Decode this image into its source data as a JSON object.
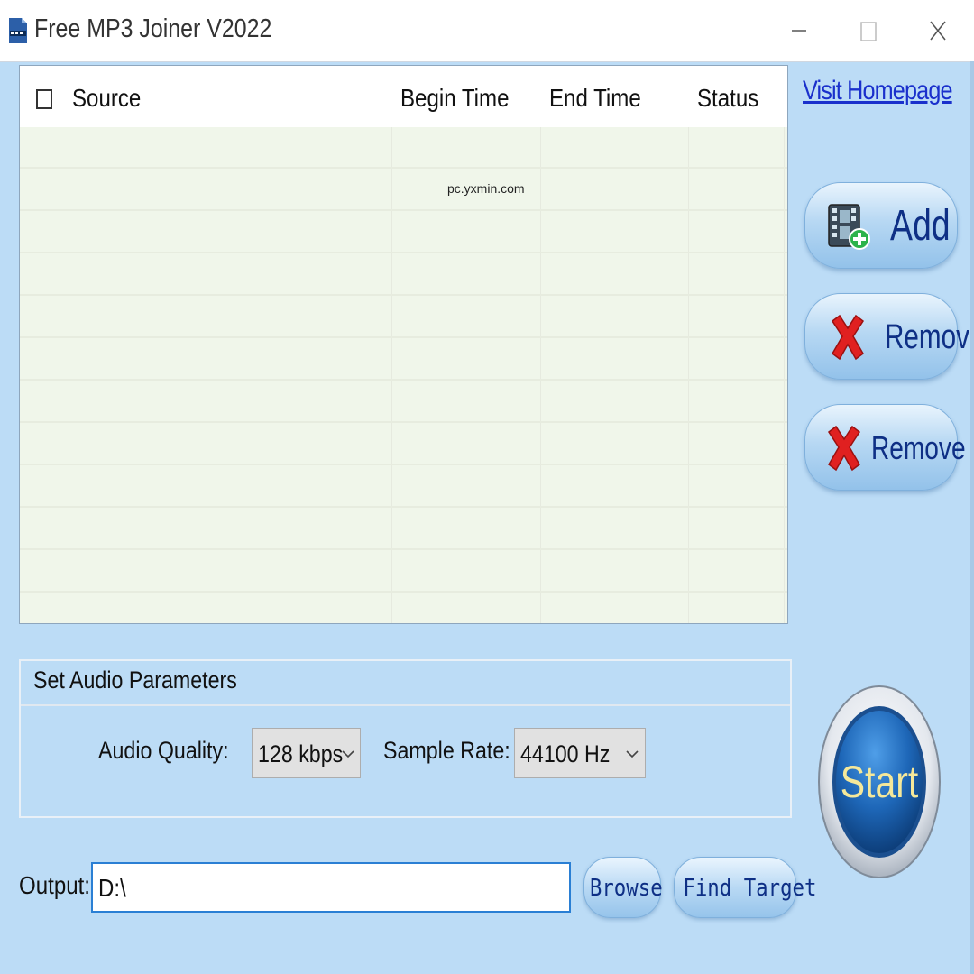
{
  "window": {
    "title": "Free MP3 Joiner V2022",
    "controls": [
      "minimize",
      "maximize",
      "close"
    ]
  },
  "file_list": {
    "columns": [
      "Source",
      "Begin Time",
      "End Time",
      "Status"
    ],
    "select_all_checked": false,
    "rows": [],
    "watermark": "pc.yxmin.com"
  },
  "sidebar": {
    "homepage_link": "Visit Homepage",
    "add_label": "Add",
    "remove_label": "Remove",
    "remove_all_label": "Remove All"
  },
  "audio_params": {
    "group_title": "Set Audio Parameters",
    "quality_label": "Audio Quality:",
    "quality_value": "128 kbps",
    "sample_rate_label": "Sample Rate:",
    "sample_rate_value": "44100 Hz"
  },
  "output": {
    "label": "Output:",
    "path": "D:\\",
    "browse_label": "Browse",
    "find_target_label": "Find Target"
  },
  "start_label": "Start",
  "colors": {
    "background": "#bcdcf6",
    "grid_background": "#f0f6ea",
    "button_text": "#0e2f85",
    "link": "#1a30cc",
    "start_blue": "#1e67b8",
    "start_text": "#f5e89a",
    "remove_red": "#e02020"
  }
}
